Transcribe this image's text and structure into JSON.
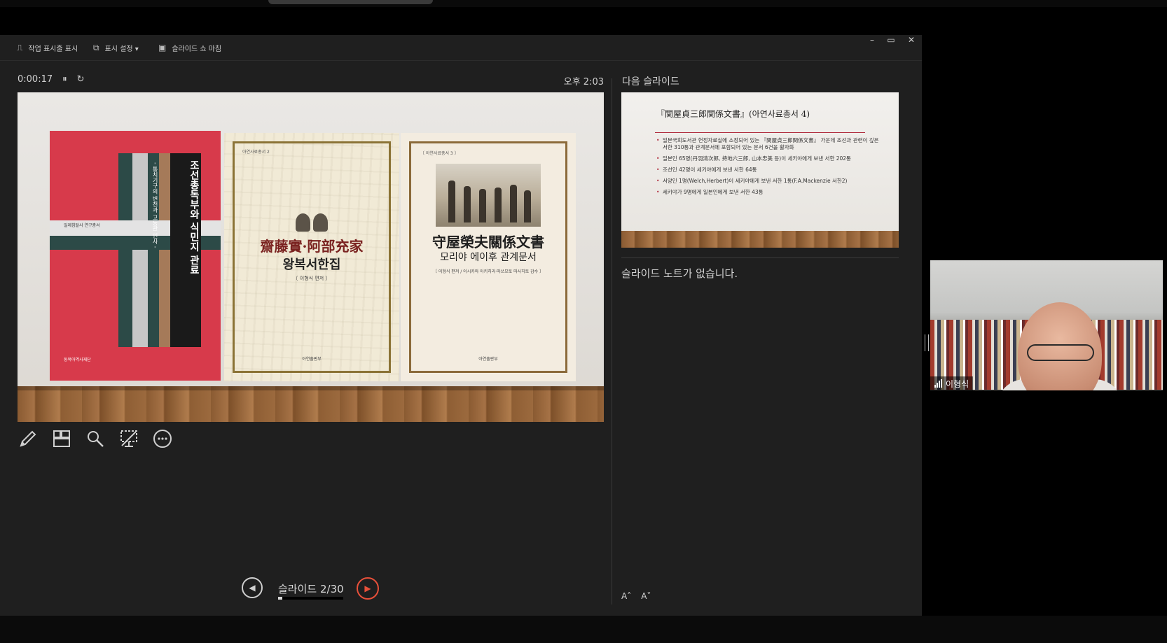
{
  "toolbar": {
    "taskbar_label": "작업 표시줄 표시",
    "display_settings_label": "표시 설정 ▾",
    "end_show_label": "슬라이드 쇼 마침"
  },
  "window_controls": {
    "minimize": "–",
    "restore": "▭",
    "close": "✕"
  },
  "presenter": {
    "elapsed": "0:00:17",
    "pause_icon": "⏸",
    "reset_icon": "↻",
    "clock": "오후 2:03",
    "slide_counter": "슬라이드 2/30",
    "progress_fraction": 0.067,
    "notes_empty": "슬라이드 노트가 없습니다.",
    "next_slide_label": "다음 슬라이드",
    "font_increase": "A˄",
    "font_decrease": "A˅"
  },
  "current_slide": {
    "book1": {
      "title": "조선총독부와 식민지 관료",
      "subtitle": "- 통치기구의 변천과 고등관 인사 -",
      "series": "일제침탈사 연구총서",
      "publisher": "동북아역사재단"
    },
    "book2": {
      "series": "아연사료총서 2",
      "title_cjk": "齋藤實·阿部充家",
      "title_kr": "왕복서한집",
      "editor": "〔 이형식 편저 〕",
      "publisher": "아연출판부"
    },
    "book3": {
      "series": "〔 아연사료총서 3 〕",
      "title_cjk": "守屋榮夫關係文書",
      "title_kr": "모리야 에이후 관계문서",
      "editors": "〔 이형식 편저 / 이시카와 아키히라·마쓰모토 마사히토 감수 〕",
      "publisher": "아연출판부"
    }
  },
  "next_slide": {
    "title": "『関屋貞三郎関係文書』(아연사료총서 4)",
    "bullets": [
      "일본국회도서관 헌정자료실에 소장되어 있는 『関屋貞三郎関係文書』 가운데 조선과 관련이 깊은 서한 310통과 관계문서에 포함되어 있는 문서 6건을 활자화",
      "일본인 65명(丹羽清次郎, 持地六三郎, 山本忠美 등)이 세키야에게 보낸 서한 202통",
      "조선인 42명이 세키야에게 보낸 서한 64통",
      "서양인 1명(Welch,Herbert)이 세키야에게 보낸 서한 1통(F.A.Mackenzie 서한2)",
      "세키야가 9명에게 일본인에게 보낸 서한 43통"
    ]
  },
  "participant": {
    "name": "이형식"
  },
  "colors": {
    "accent_next": "#e8503a",
    "window_bg": "#1f1f1f"
  }
}
